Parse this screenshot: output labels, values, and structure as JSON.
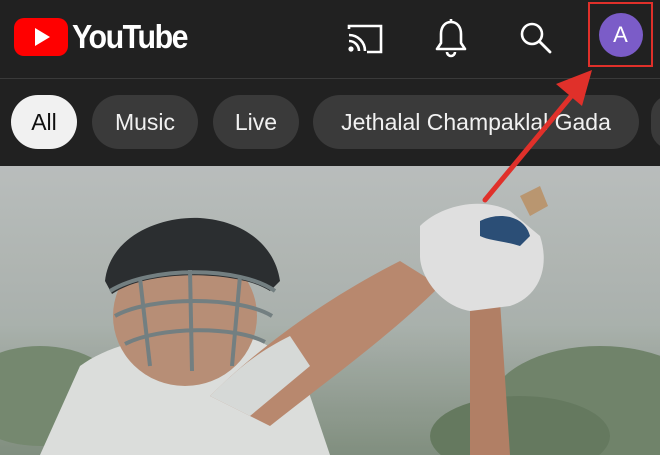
{
  "app": {
    "brand": "YouTube"
  },
  "header": {
    "icons": [
      "cast-icon",
      "bell-icon",
      "search-icon"
    ],
    "avatar_letter": "A"
  },
  "chips": [
    {
      "label": "All",
      "active": true
    },
    {
      "label": "Music",
      "active": false
    },
    {
      "label": "Live",
      "active": false
    },
    {
      "label": "Jethalal Champaklal Gada",
      "active": false
    }
  ],
  "colors": {
    "brand_red": "#ff0000",
    "header_bg": "#212121",
    "avatar_bg": "#7b5cc8",
    "annotation_red": "#e0302a"
  }
}
